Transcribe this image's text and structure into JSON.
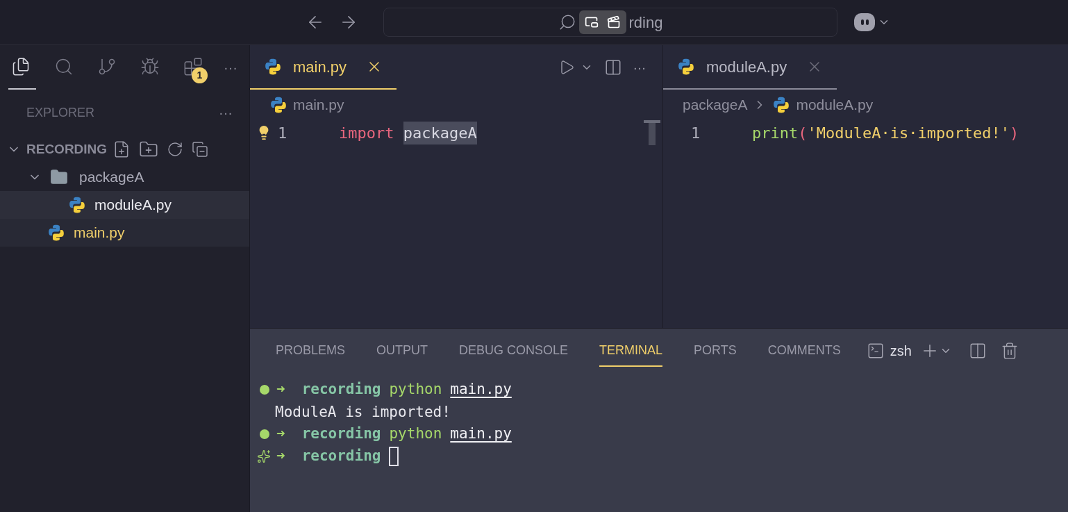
{
  "title_bar": {
    "search": {
      "value": "rding"
    }
  },
  "activity_bar": {
    "items": [
      {
        "kind": "files",
        "selected": true
      },
      {
        "kind": "search",
        "selected": false
      },
      {
        "kind": "source-control",
        "selected": false
      },
      {
        "kind": "run-debug",
        "selected": false
      },
      {
        "kind": "extensions",
        "selected": false,
        "badge": "1"
      }
    ],
    "more": "···"
  },
  "sidebar": {
    "title": "EXPLORER",
    "more": "···",
    "tree": [
      {
        "name": "RECORDING",
        "kind": "root",
        "expanded": true,
        "children": [
          {
            "name": "packageA",
            "kind": "folder",
            "expanded": true,
            "hovered": false,
            "selected": false,
            "children": [
              {
                "name": "moduleA.py",
                "kind": "python",
                "hovered": true,
                "selected": false
              }
            ]
          },
          {
            "name": "main.py",
            "kind": "python",
            "hovered": false,
            "selected": true
          }
        ]
      }
    ]
  },
  "editor_groups": [
    {
      "tab": {
        "label": "main.py",
        "active": true
      },
      "more": "···",
      "breadcrumbs": [
        "main.py"
      ],
      "lines": [
        {
          "number": "1",
          "lightbulb": true,
          "tokens": [
            {
              "kind": "keyword",
              "text": "import"
            },
            {
              "kind": "highlight",
              "text": "packageA"
            }
          ]
        }
      ]
    },
    {
      "tab": {
        "label": "moduleA.py",
        "active": false
      },
      "breadcrumbs": [
        "packageA",
        "moduleA.py"
      ],
      "lines": [
        {
          "number": "1",
          "tokens": [
            {
              "kind": "function",
              "text": "print"
            },
            {
              "kind": "paren",
              "text": "("
            },
            {
              "kind": "string",
              "text": "'ModuleA·is·imported!'"
            },
            {
              "kind": "paren",
              "text": ")"
            }
          ]
        }
      ]
    }
  ],
  "panel": {
    "tabs": [
      {
        "label": "PROBLEMS",
        "selected": false
      },
      {
        "label": "OUTPUT",
        "selected": false
      },
      {
        "label": "DEBUG CONSOLE",
        "selected": false
      },
      {
        "label": "TERMINAL",
        "selected": true
      },
      {
        "label": "PORTS",
        "selected": false
      },
      {
        "label": "COMMENTS",
        "selected": false
      }
    ],
    "shell": "zsh"
  },
  "terminal": {
    "lines": [
      {
        "kind": "prompt",
        "done": true,
        "arrow": "➜",
        "dir": "recording",
        "command": "python",
        "arg": "main.py"
      },
      {
        "kind": "output",
        "text": "ModuleA is imported!"
      },
      {
        "kind": "prompt",
        "done": true,
        "arrow": "➜",
        "dir": "recording",
        "command": "python",
        "arg": "main.py"
      },
      {
        "kind": "prompt",
        "done": false,
        "arrow": "➜",
        "dir": "recording",
        "cursor": true
      }
    ]
  }
}
